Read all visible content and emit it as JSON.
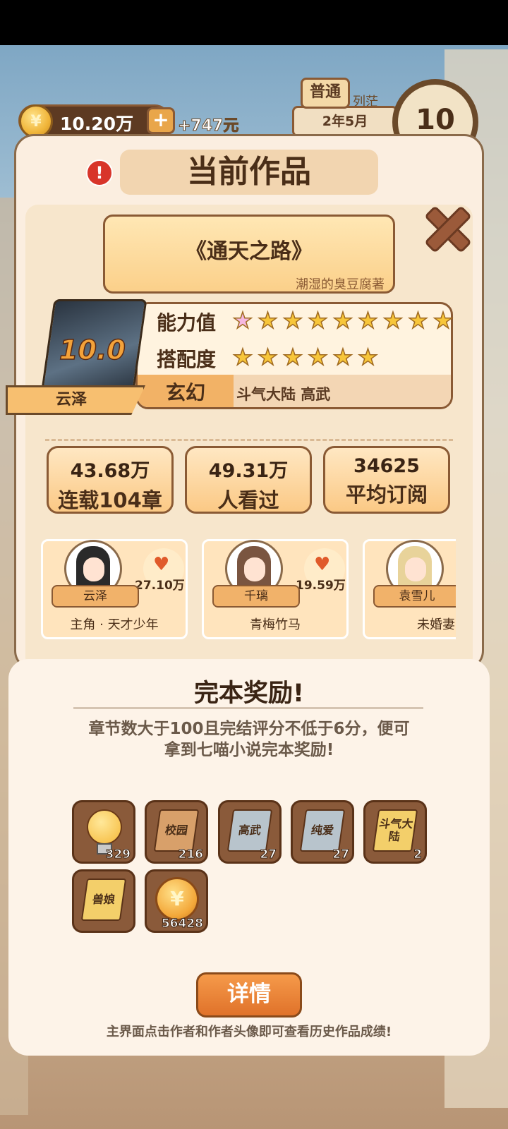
{
  "hud": {
    "coin_icon": "yuan-coin-icon",
    "coins": "10.20万",
    "plus": "+",
    "earn": "+747元",
    "mode": "普通",
    "date": "2年5月",
    "date_peek": "列茫",
    "level": "10"
  },
  "modal": {
    "title": "当前作品",
    "warn": "!",
    "book": {
      "name": "《通天之路》",
      "author": "潮湿的臭豆腐著",
      "score": "10.0",
      "protagonist": "云泽"
    },
    "ability_label": "能力值",
    "ability_stars": 9,
    "match_label": "搭配度",
    "match_stars": 6,
    "genre": "玄幻",
    "tags": "斗气大陆  高武",
    "stats": [
      {
        "num": "43.68万",
        "desc": "连载104章"
      },
      {
        "num": "49.31万",
        "desc": "人看过"
      },
      {
        "num": "34625",
        "desc": "平均订阅"
      }
    ],
    "characters": [
      {
        "name": "云泽",
        "likes": "27.10万",
        "role": "主角 · 天才少年",
        "hair": "#2a2a2a"
      },
      {
        "name": "千璃",
        "likes": "19.59万",
        "role": "青梅竹马",
        "hair": "#7a5540"
      },
      {
        "name": "袁雪儿",
        "likes": "",
        "role": "未婚妻",
        "hair": "#e8d39a"
      }
    ]
  },
  "reward": {
    "title": "完本奖励!",
    "desc_line1": "章节数大于100且完结评分不低于6分，便可",
    "desc_line2": "拿到七喵小说完本奖励!",
    "items": [
      {
        "type": "bulb",
        "label": "",
        "count": "329"
      },
      {
        "type": "book",
        "label": "校园",
        "count": "216",
        "color": "#d8a06a"
      },
      {
        "type": "book",
        "label": "高武",
        "count": "27",
        "color": "#b8c4cc"
      },
      {
        "type": "book",
        "label": "纯爱",
        "count": "27",
        "color": "#b8c4cc"
      },
      {
        "type": "book",
        "label": "斗气大陆",
        "count": "2",
        "color": "#f3cf6a"
      },
      {
        "type": "book",
        "label": "兽娘",
        "count": "",
        "color": "#f3cf6a"
      },
      {
        "type": "coin",
        "label": "¥",
        "count": "56428"
      }
    ],
    "detail_button": "详情",
    "hint": "主界面点击作者和作者头像即可查看历史作品成绩!"
  }
}
